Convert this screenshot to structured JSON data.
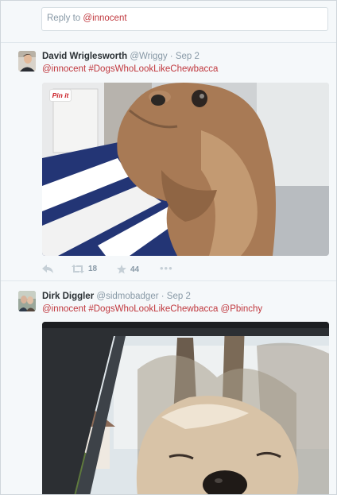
{
  "reply": {
    "prefix": "Reply to ",
    "mention": "@innocent"
  },
  "tweets": [
    {
      "name": "David Wriglesworth",
      "handle": "@Wriggy",
      "time": "· Sep 2",
      "text": "@innocent #DogsWhoLookLikeChewbacca",
      "pin_label": "Pin it",
      "retweets": "18",
      "favorites": "44"
    },
    {
      "name": "Dirk Diggler",
      "handle": "@sidmobadger",
      "time": "· Sep 2",
      "text": "@innocent #DogsWhoLookLikeChewbacca @Pbinchy"
    }
  ],
  "icons": {
    "reply": "reply-icon",
    "retweet": "retweet-icon",
    "favorite": "star-icon",
    "more": "more-icon"
  },
  "colors": {
    "link": "#c0383e",
    "muted": "#8899a6",
    "background": "#f5f8fa"
  }
}
